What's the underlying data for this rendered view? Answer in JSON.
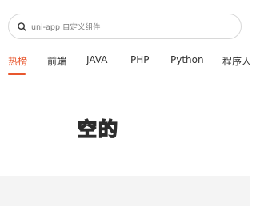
{
  "search": {
    "placeholder": "uni-app 自定义组件",
    "icon": "search-icon"
  },
  "tabs": [
    {
      "label": "热榜",
      "active": true
    },
    {
      "label": "前端",
      "active": false
    },
    {
      "label": "JAVA",
      "active": false
    },
    {
      "label": "PHP",
      "active": false
    },
    {
      "label": "Python",
      "active": false
    },
    {
      "label": "程序人生",
      "active": false
    }
  ],
  "empty_state": {
    "text": "空的"
  },
  "colors": {
    "accent": "#e8572e",
    "empty_text_fill": "#e6e61a",
    "empty_text_outline": "#2d2d2d",
    "footer_band": "#f4f4f4"
  }
}
